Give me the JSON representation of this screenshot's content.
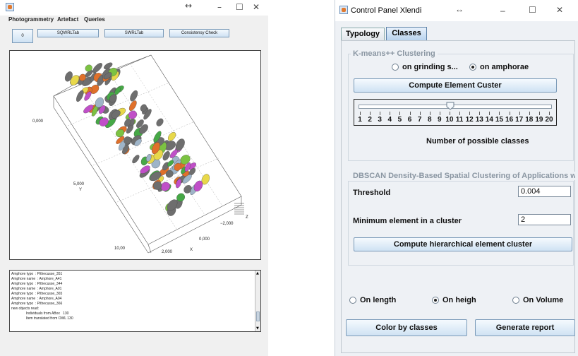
{
  "left_window": {
    "menu": [
      "Photogrammetry",
      "Artefact",
      "Queries"
    ],
    "toolbar": {
      "small_button": "0",
      "buttons": [
        "SQWRLTab",
        "SWRLTab",
        "Consistensy Check"
      ]
    },
    "plot": {
      "ticks": {
        "z_top": "0,000",
        "y_mid": "5,000",
        "y_label": "Y",
        "y_bottom": "10,00",
        "x1": "2,000",
        "x_label": "X",
        "x2": "0,000",
        "x3": "−2,000",
        "z_label": "Z"
      }
    },
    "console": {
      "lines": [
        "Amphore typo  : Pithecusse_351",
        "Amphore name  : Amphore_A41",
        "Amphore typo  : Pithecusse_344",
        "Amphore name  : Amphore_A01",
        "Amphore typo  : Pithecusse_365",
        "Amphore name  : Amphore_A04",
        "Amphore typo  : Pithecusse_366",
        "new objects read:",
        "               Individuals from ABox   130",
        "               Item translated from OWL 130"
      ]
    },
    "colors": {
      "accent": "#7a9ab8",
      "gray_item": "#6e6e6e"
    }
  },
  "right_window": {
    "title": "Control Panel Xlendi",
    "tabs": [
      "Typology",
      "Classes"
    ],
    "active_tab": "Classes",
    "kmeans": {
      "legend": "K-means++ Clustering",
      "radio_grinding": "on grinding s...",
      "radio_amphorae": "on amphorae",
      "selected": "on amphorae",
      "compute_button": "Compute Element Custer",
      "slider_labels": [
        "1",
        "2",
        "3",
        "4",
        "5",
        "6",
        "7",
        "8",
        "9",
        "10",
        "11",
        "12",
        "13",
        "14",
        "15",
        "16",
        "17",
        "18",
        "19",
        "20"
      ],
      "slider_value": 10,
      "slider_caption": "Number of possible classes"
    },
    "dbscan": {
      "legend": "DBSCAN Density-Based Spatial Clustering of Applications wi...",
      "threshold_label": "Threshold",
      "threshold_value": "0.004",
      "min_label": "Minimum element in a cluster",
      "min_value": "2",
      "compute_button": "Compute hierarchical element cluster"
    },
    "measure": {
      "options": [
        "On length",
        "On heigh",
        "On Volume"
      ],
      "selected": "On heigh"
    },
    "buttons": {
      "color": "Color by classes",
      "report": "Generate report"
    }
  }
}
